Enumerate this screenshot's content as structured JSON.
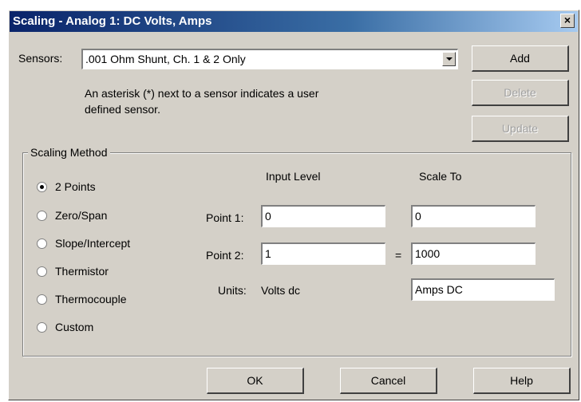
{
  "window": {
    "title": "Scaling - Analog 1: DC Volts, Amps",
    "close_glyph": "×"
  },
  "sensors": {
    "label": "Sensors:",
    "selected": ".001 Ohm Shunt, Ch. 1 & 2 Only",
    "note": "An asterisk (*) next to a sensor indicates a user defined sensor.",
    "note_line1": "An asterisk (*) next to a sensor indicates a user",
    "note_line2": "defined sensor."
  },
  "buttons": {
    "add": "Add",
    "delete": "Delete",
    "update": "Update",
    "ok": "OK",
    "cancel": "Cancel",
    "help": "Help"
  },
  "scaling_method": {
    "title": "Scaling Method",
    "options": [
      {
        "label": "2 Points",
        "checked": true
      },
      {
        "label": "Zero/Span",
        "checked": false
      },
      {
        "label": "Slope/Intercept",
        "checked": false
      },
      {
        "label": "Thermistor",
        "checked": false
      },
      {
        "label": "Thermocouple",
        "checked": false
      },
      {
        "label": "Custom",
        "checked": false
      }
    ]
  },
  "points": {
    "input_level_header": "Input Level",
    "scale_to_header": "Scale To",
    "point1_label": "Point 1:",
    "point1_input": "0",
    "point1_scale": "0",
    "point2_label": "Point 2:",
    "point2_input": "1",
    "point2_scale": "1000",
    "equals": "=",
    "units_label": "Units:",
    "input_units": "Volts dc",
    "scale_units": "Amps DC"
  }
}
